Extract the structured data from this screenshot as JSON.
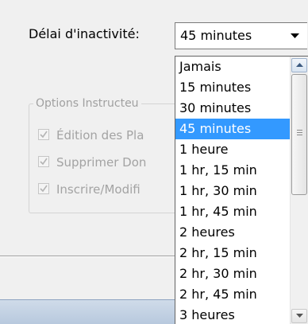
{
  "settings": {
    "timeout_label": "Délai d'inactivité:",
    "timeout_value": "45 minutes"
  },
  "instructor_options": {
    "title": "Options Instructeu",
    "items": [
      {
        "label": "Édition des Pla",
        "checked": true
      },
      {
        "label": "Supprimer Don",
        "checked": true
      },
      {
        "label": "Inscrire/Modifi",
        "checked": true
      }
    ]
  },
  "timeout_dropdown": {
    "selected": "45 minutes",
    "options": [
      "Jamais",
      "15 minutes",
      "30 minutes",
      "45 minutes",
      "1 heure",
      "1 hr, 15 min",
      "1 hr, 30 min",
      "1 hr, 45 min",
      "2 heures",
      "2 hr, 15 min",
      "2 hr, 30 min",
      "2 hr, 45 min",
      "3 heures"
    ]
  },
  "icons": {
    "combo_arrow": "chevron-down-icon",
    "scroll_up": "scroll-up-arrow-icon",
    "scroll_down": "scroll-down-arrow-icon",
    "checkbox_mark": "checkmark-icon"
  },
  "colors": {
    "selection": "#3399ff",
    "disabled_text": "#a3a3a3"
  }
}
